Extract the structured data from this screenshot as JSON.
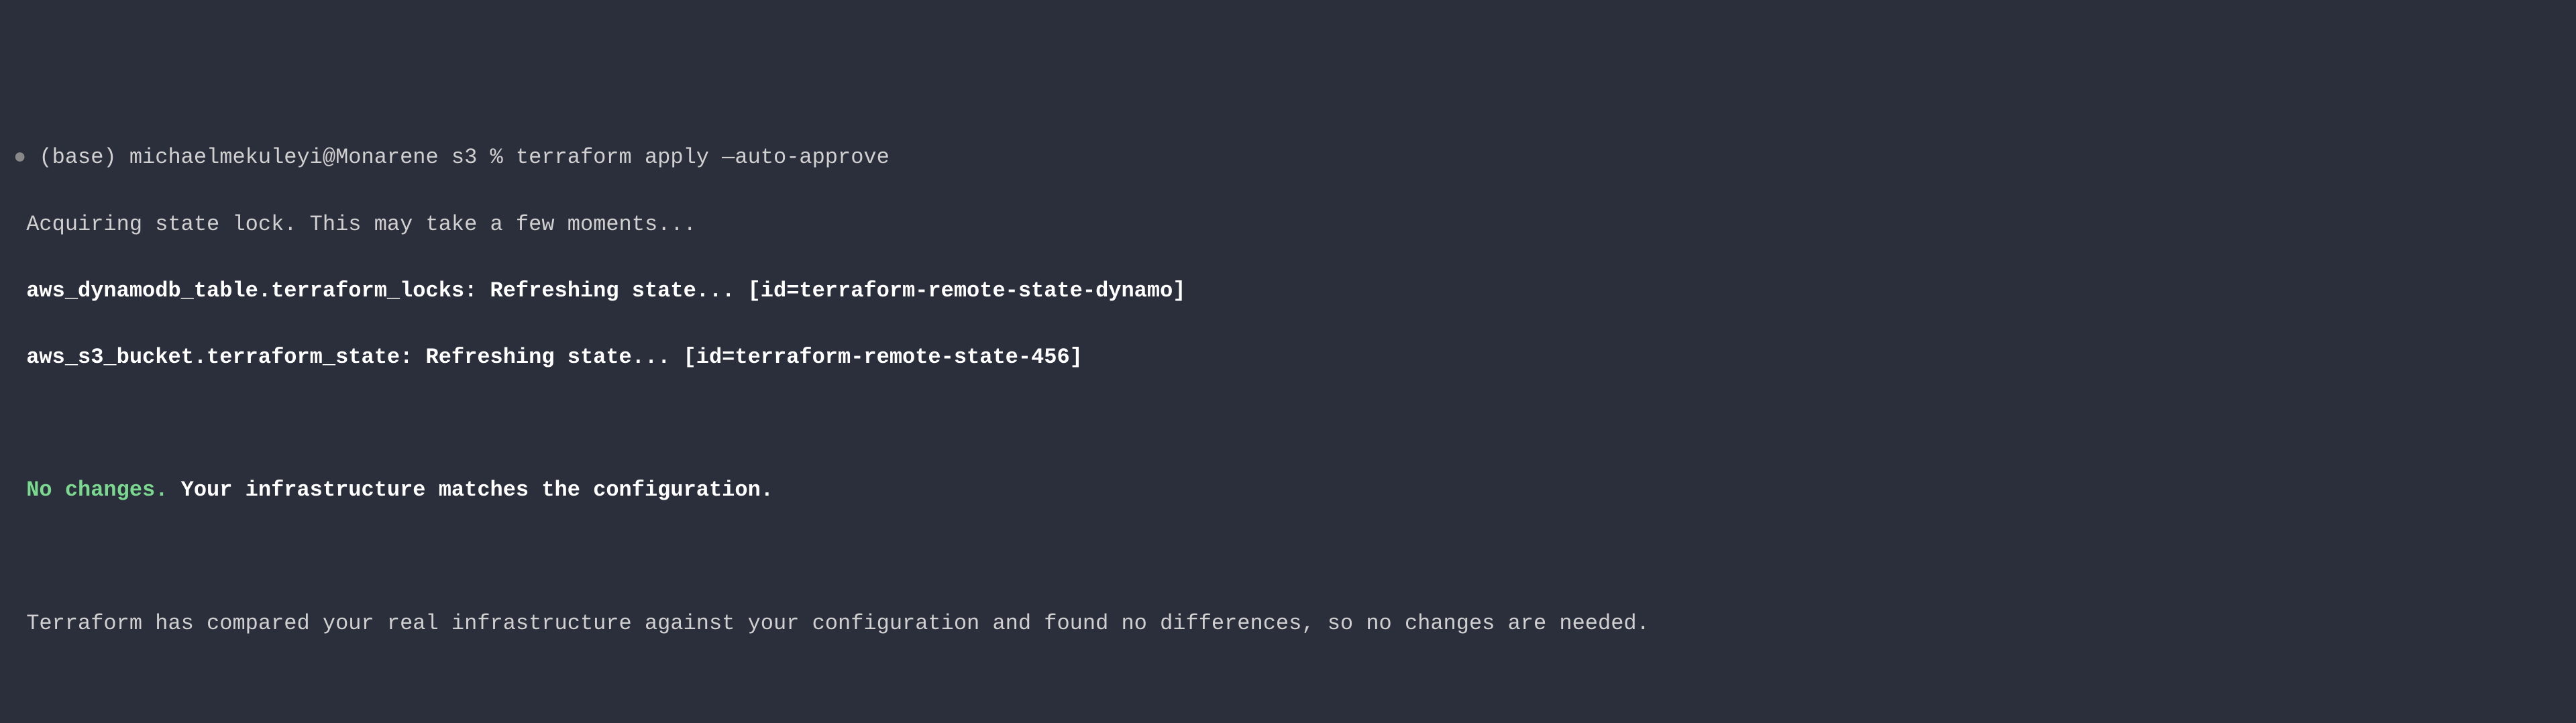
{
  "terminal": {
    "prompt_bullet": "●",
    "prompt_prefix": "(base) michaelmekuleyi@Monarene s3 %",
    "command": "terraform apply —auto-approve",
    "line_acquiring": " Acquiring state lock. This may take a few moments...",
    "line_dynamodb": " aws_dynamodb_table.terraform_locks: Refreshing state... [id=terraform-remote-state-dynamo]",
    "line_s3bucket": " aws_s3_bucket.terraform_state: Refreshing state... [id=terraform-remote-state-456]",
    "no_changes_label": " No changes.",
    "no_changes_rest": " Your infrastructure matches the configuration.",
    "line_compared": " Terraform has compared your real infrastructure against your configuration and found no differences, so no changes are needed."
  }
}
